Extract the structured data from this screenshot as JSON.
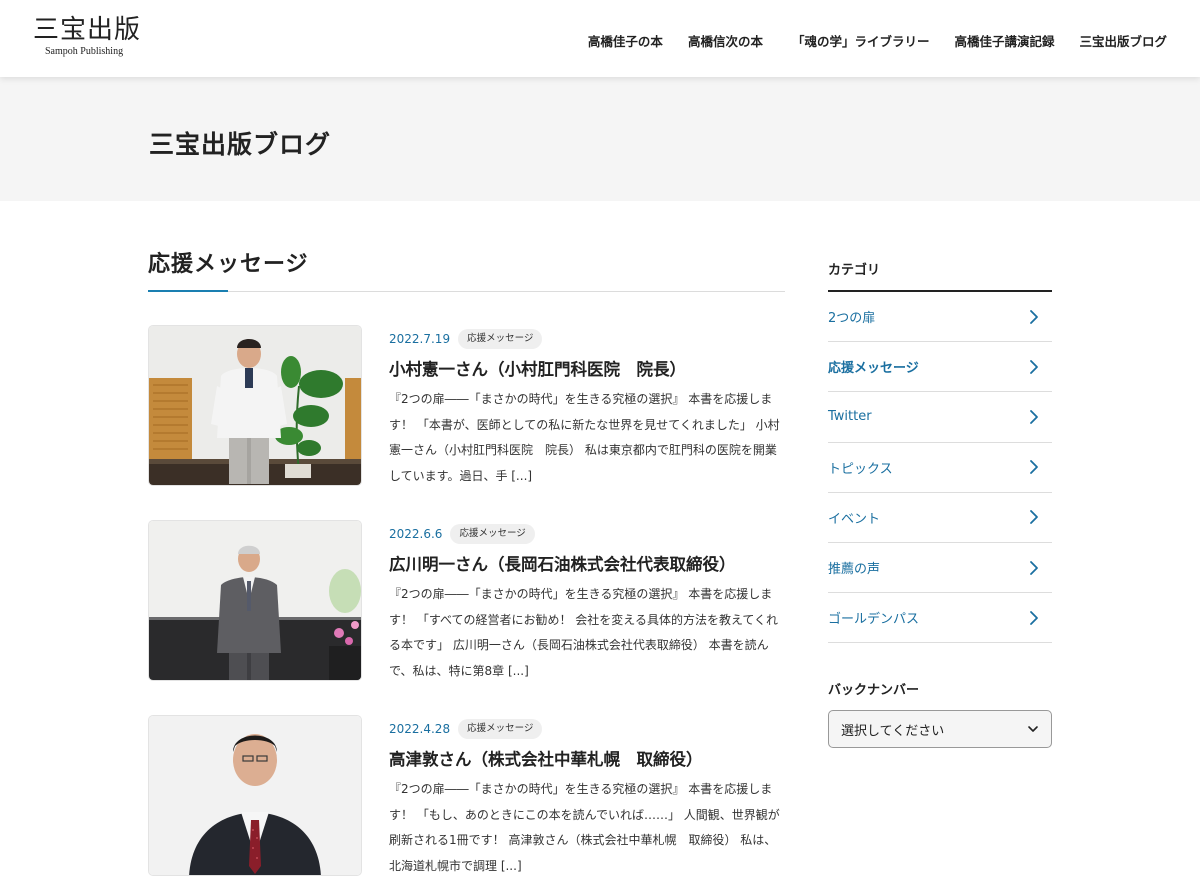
{
  "header": {
    "logo_main": "三宝出版",
    "logo_sub": "Sampoh Publishing",
    "nav": [
      {
        "label": "高橋佳子の本"
      },
      {
        "label": "高橋信次の本"
      },
      {
        "label": "「魂の学」ライブラリー"
      },
      {
        "label": "高橋佳子講演記録"
      },
      {
        "label": "三宝出版ブログ"
      }
    ]
  },
  "page": {
    "title": "三宝出版ブログ"
  },
  "main": {
    "section_title": "応援メッセージ",
    "accent_color": "#1a7fb1",
    "posts": [
      {
        "date": "2022.7.19",
        "category": "応援メッセージ",
        "title": "小村憲一さん（小村肛門科医院　院長）",
        "excerpt": "『2つの扉――「まさかの時代」を生きる究極の選択』 本書を応援します！ 「本書が、医師としての私に新たな世界を見せてくれました」 小村憲一さん（小村肛門科医院　院長） 私は東京都内で肛門科の医院を開業しています。過日、手 [...]"
      },
      {
        "date": "2022.6.6",
        "category": "応援メッセージ",
        "title": "広川明一さん（長岡石油株式会社代表取締役）",
        "excerpt": "『2つの扉――「まさかの時代」を生きる究極の選択』 本書を応援します！ 「すべての経営者にお勧め！ 会社を変える具体的方法を教えてくれる本です」 広川明一さん（長岡石油株式会社代表取締役） 本書を読んで、私は、特に第8章 [...]"
      },
      {
        "date": "2022.4.28",
        "category": "応援メッセージ",
        "title": "高津敦さん（株式会社中華札幌　取締役）",
        "excerpt": "『2つの扉――「まさかの時代」を生きる究極の選択』 本書を応援します！ 「もし、あのときにこの本を読んでいれば……」 人間観、世界観が刷新される1冊です！ 高津敦さん（株式会社中華札幌　取締役） 私は、北海道札幌市で調理 [...]"
      }
    ]
  },
  "sidebar": {
    "category_heading": "カテゴリ",
    "categories": [
      {
        "label": "2つの扉"
      },
      {
        "label": "応援メッセージ"
      },
      {
        "label": "Twitter"
      },
      {
        "label": "トピックス"
      },
      {
        "label": "イベント"
      },
      {
        "label": "推薦の声"
      },
      {
        "label": "ゴールデンパス"
      }
    ],
    "archive_heading": "バックナンバー",
    "archive_select": "選択してください",
    "link_color": "#1a6fa0"
  }
}
